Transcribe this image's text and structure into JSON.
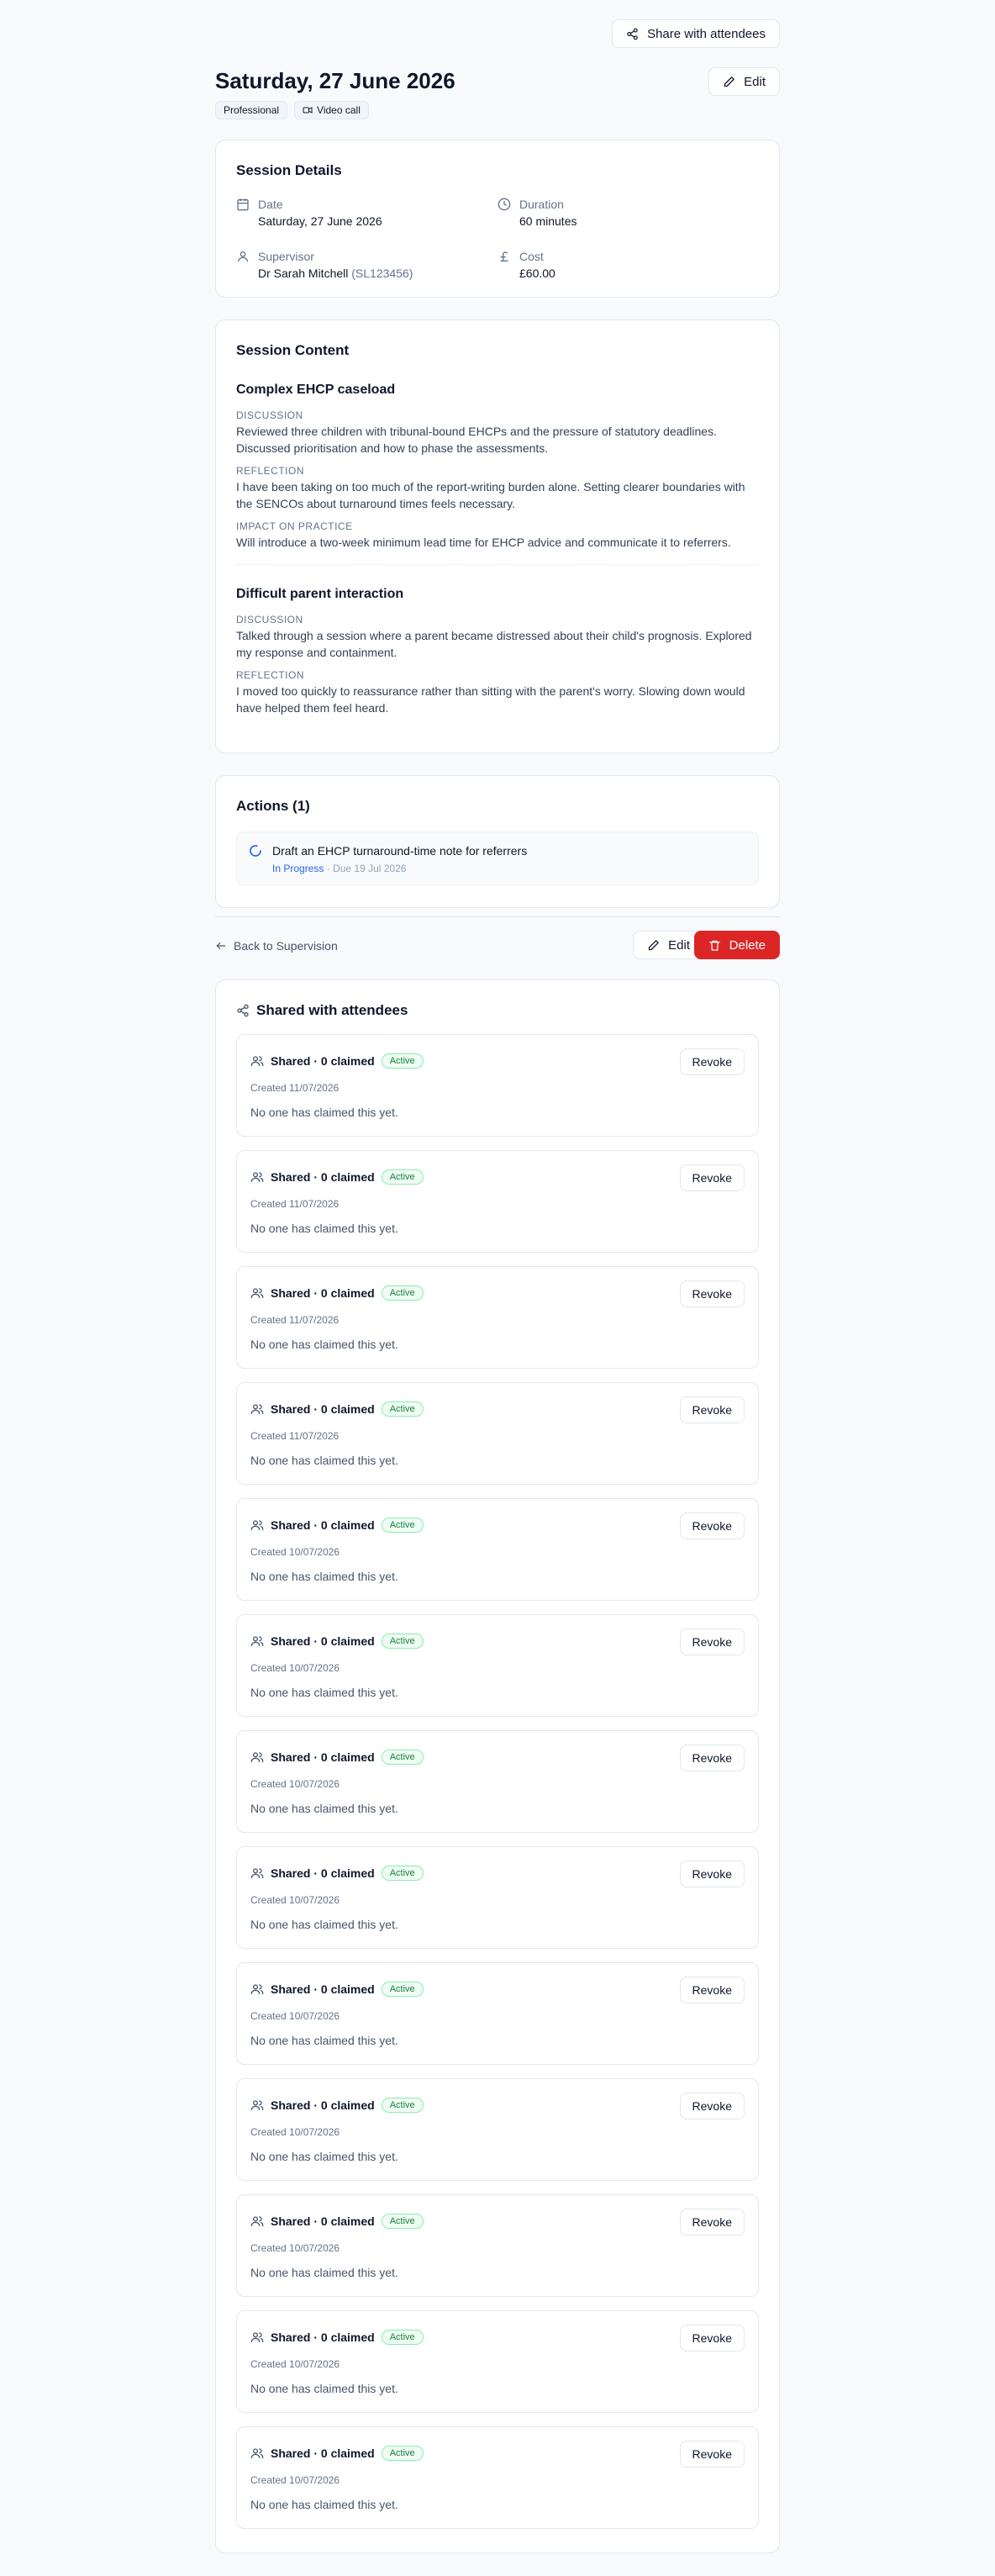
{
  "header": {
    "share_label": "Share with attendees",
    "title": "Saturday, 27 June 2026",
    "edit_label": "Edit",
    "tags": [
      "Professional",
      "Video call"
    ]
  },
  "details": {
    "heading": "Session Details",
    "date_label": "Date",
    "date_value": "Saturday, 27 June 2026",
    "duration_label": "Duration",
    "duration_value": "60 minutes",
    "supervisor_label": "Supervisor",
    "supervisor_name": "Dr Sarah Mitchell",
    "supervisor_id": "(SL123456)",
    "cost_label": "Cost",
    "cost_value": "£60.00"
  },
  "content": {
    "heading": "Session Content",
    "topics": [
      {
        "title": "Complex EHCP caseload",
        "sections": [
          {
            "label": "Discussion",
            "text": "Reviewed three children with tribunal-bound EHCPs and the pressure of statutory deadlines. Discussed prioritisation and how to phase the assessments."
          },
          {
            "label": "Reflection",
            "text": "I have been taking on too much of the report-writing burden alone. Setting clearer boundaries with the SENCOs about turnaround times feels necessary."
          },
          {
            "label": "Impact on Practice",
            "text": "Will introduce a two-week minimum lead time for EHCP advice and communicate it to referrers."
          }
        ]
      },
      {
        "title": "Difficult parent interaction",
        "sections": [
          {
            "label": "Discussion",
            "text": "Talked through a session where a parent became distressed about their child's prognosis. Explored my response and containment."
          },
          {
            "label": "Reflection",
            "text": "I moved too quickly to reassurance rather than sitting with the parent's worry. Slowing down would have helped them feel heard."
          }
        ]
      }
    ]
  },
  "actions": {
    "heading": "Actions (1)",
    "items": [
      {
        "title": "Draft an EHCP turnaround-time note for referrers",
        "status": "In Progress",
        "due": "Due 19 Jul 2026"
      }
    ]
  },
  "footer": {
    "back_label": "Back to Supervision",
    "edit_label": "Edit",
    "delete_label": "Delete"
  },
  "shared": {
    "heading": "Shared with attendees",
    "revoke_label": "Revoke",
    "cards": [
      {
        "summary": "Shared · 0 claimed",
        "status": "Active",
        "created": "Created 11/07/2026",
        "note": "No one has claimed this yet."
      },
      {
        "summary": "Shared · 0 claimed",
        "status": "Active",
        "created": "Created 11/07/2026",
        "note": "No one has claimed this yet."
      },
      {
        "summary": "Shared · 0 claimed",
        "status": "Active",
        "created": "Created 11/07/2026",
        "note": "No one has claimed this yet."
      },
      {
        "summary": "Shared · 0 claimed",
        "status": "Active",
        "created": "Created 11/07/2026",
        "note": "No one has claimed this yet."
      },
      {
        "summary": "Shared · 0 claimed",
        "status": "Active",
        "created": "Created 10/07/2026",
        "note": "No one has claimed this yet."
      },
      {
        "summary": "Shared · 0 claimed",
        "status": "Active",
        "created": "Created 10/07/2026",
        "note": "No one has claimed this yet."
      },
      {
        "summary": "Shared · 0 claimed",
        "status": "Active",
        "created": "Created 10/07/2026",
        "note": "No one has claimed this yet."
      },
      {
        "summary": "Shared · 0 claimed",
        "status": "Active",
        "created": "Created 10/07/2026",
        "note": "No one has claimed this yet."
      },
      {
        "summary": "Shared · 0 claimed",
        "status": "Active",
        "created": "Created 10/07/2026",
        "note": "No one has claimed this yet."
      },
      {
        "summary": "Shared · 0 claimed",
        "status": "Active",
        "created": "Created 10/07/2026",
        "note": "No one has claimed this yet."
      },
      {
        "summary": "Shared · 0 claimed",
        "status": "Active",
        "created": "Created 10/07/2026",
        "note": "No one has claimed this yet."
      },
      {
        "summary": "Shared · 0 claimed",
        "status": "Active",
        "created": "Created 10/07/2026",
        "note": "No one has claimed this yet."
      },
      {
        "summary": "Shared · 0 claimed",
        "status": "Active",
        "created": "Created 10/07/2026",
        "note": "No one has claimed this yet."
      }
    ]
  }
}
